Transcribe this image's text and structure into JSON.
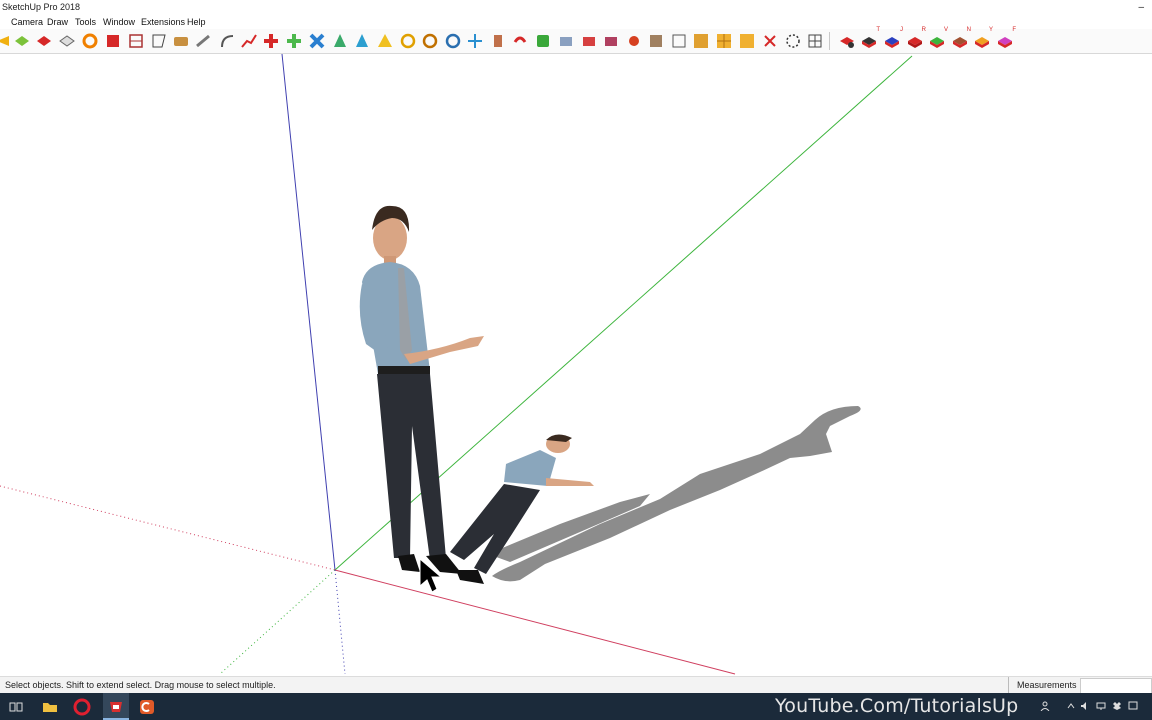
{
  "window": {
    "title": "SketchUp Pro 2018",
    "minimize_glyph": "–"
  },
  "menu": {
    "items": [
      "Camera",
      "Draw",
      "Tools",
      "Window",
      "Extensions",
      "Help"
    ]
  },
  "toolbar": {
    "icons": [
      "select-icon",
      "paint-bucket-icon",
      "eraser-icon",
      "rectangle-icon",
      "push-pull-icon",
      "follow-me-icon",
      "section-plane-icon",
      "offset-icon",
      "tape-measure-icon",
      "protractor-icon",
      "arc-icon",
      "freehand-icon",
      "move-icon",
      "rotate-icon",
      "scale-icon",
      "dimension-icon",
      "text-icon",
      "axes-icon",
      "orbit-icon",
      "pan-icon",
      "zoom-icon",
      "zoom-extents-icon",
      "walk-icon",
      "look-around-icon",
      "position-camera-icon",
      "solid-tools-icon",
      "sandbox-icon",
      "warehouse-icon",
      "extension-warehouse-icon",
      "layout-icon",
      "style-icon",
      "shadow-icon",
      "grid-icon",
      "intersect-icon",
      "outer-shell-icon",
      "split-icon",
      "trim-icon",
      "union-icon"
    ],
    "views": [
      {
        "icon": "iso-view-icon",
        "letter": ""
      },
      {
        "icon": "top-view-icon",
        "letter": "T"
      },
      {
        "icon": "bottom-view-icon",
        "letter": "J"
      },
      {
        "icon": "front-view-icon",
        "letter": "R"
      },
      {
        "icon": "right-view-icon",
        "letter": "V"
      },
      {
        "icon": "back-view-icon",
        "letter": "N"
      },
      {
        "icon": "left-view-icon",
        "letter": "Y"
      },
      {
        "icon": "face-view-icon",
        "letter": "F"
      }
    ]
  },
  "status": {
    "message": "Select objects. Shift to extend select. Drag mouse to select multiple.",
    "measurements_label": "Measurements",
    "measurements_value": ""
  },
  "taskbar": {
    "watermark": "YouTube.Com/TutorialsUp",
    "apps": [
      "task-view-icon",
      "file-explorer-icon",
      "opera-icon",
      "sketchup-icon",
      "camtasia-icon"
    ]
  },
  "colors": {
    "red_axis": "#d04060",
    "green_axis": "#3cb43c",
    "blue_axis": "#4040b0",
    "shadow": "#8c8c8c",
    "taskbar": "#1b2a3a"
  }
}
